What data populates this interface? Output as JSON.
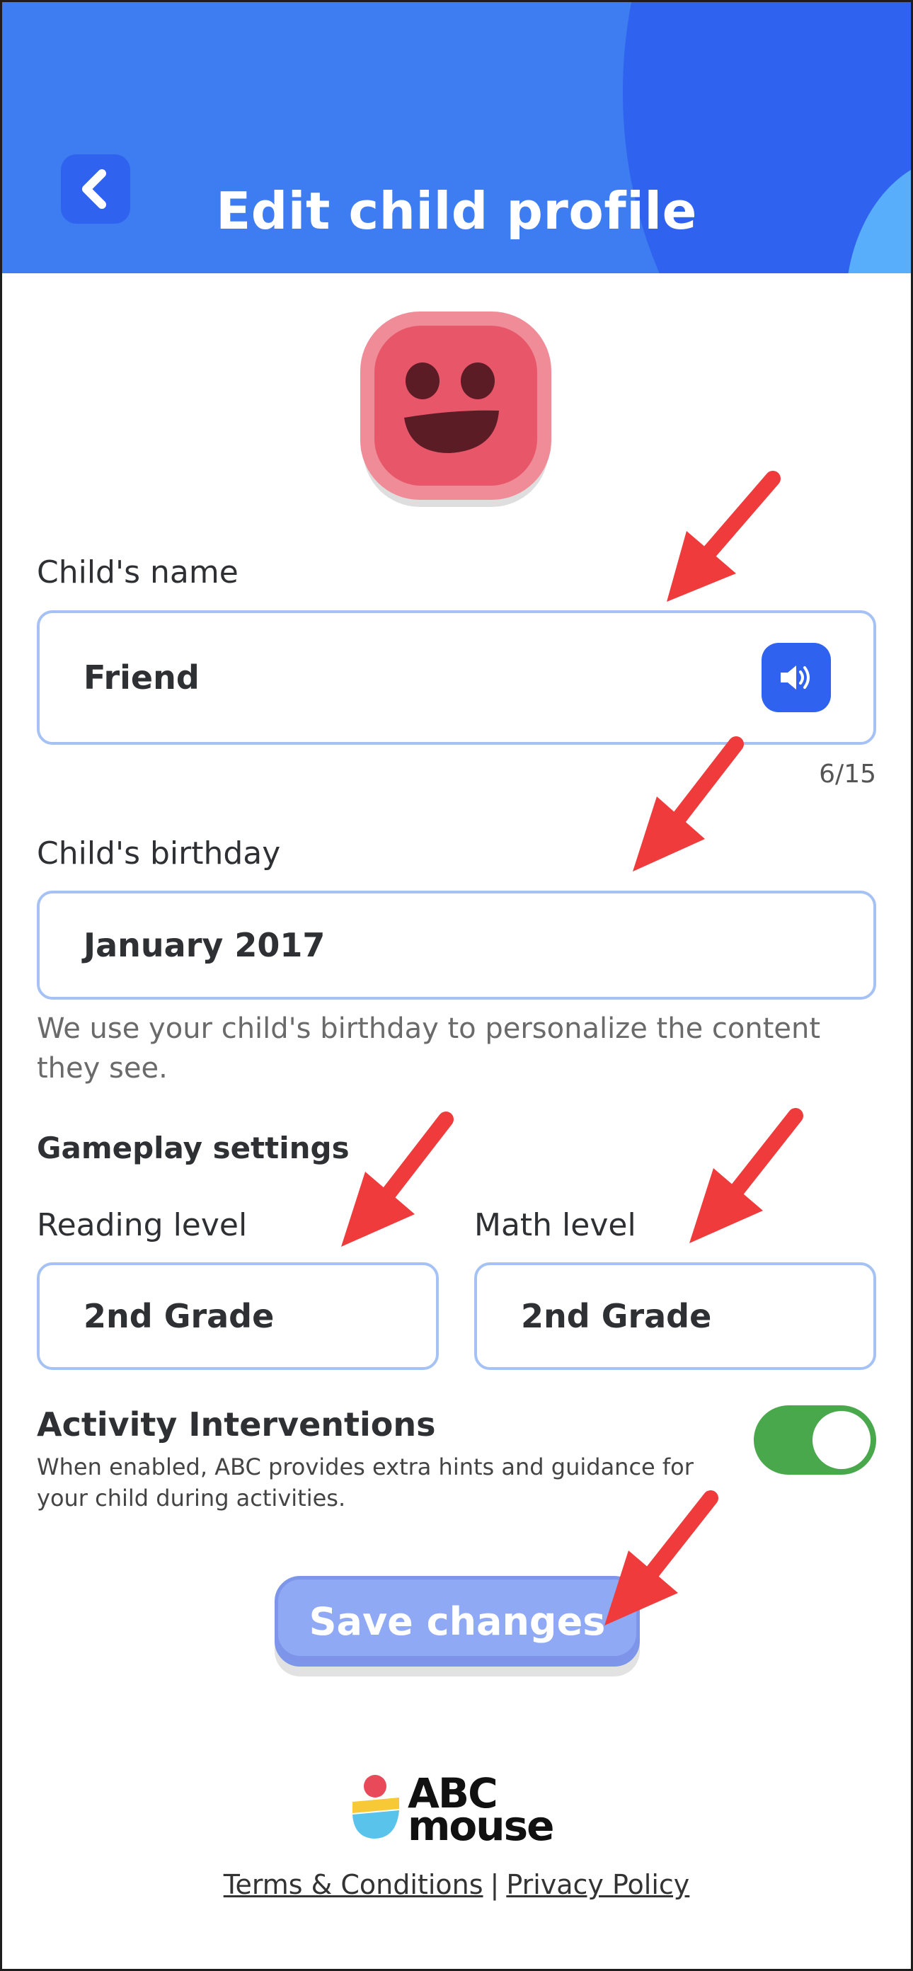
{
  "header": {
    "title": "Edit child profile",
    "back_icon": "chevron-left-icon"
  },
  "avatar": {
    "icon": "smiling-face-avatar",
    "color": "#e8566a"
  },
  "name_field": {
    "label": "Child's name",
    "value": "Friend",
    "counter": "6/15",
    "speaker_icon": "speaker-icon"
  },
  "birthday_field": {
    "label": "Child's birthday",
    "value": "January 2017",
    "helper": "We use your child's birthday to personalize the content they see."
  },
  "gameplay": {
    "title": "Gameplay settings",
    "reading": {
      "label": "Reading level",
      "value": "2nd Grade"
    },
    "math": {
      "label": "Math level",
      "value": "2nd Grade"
    }
  },
  "interventions": {
    "title": "Activity Interventions",
    "description": "When enabled, ABC provides extra hints and guidance for your child during activities.",
    "enabled": true
  },
  "save_label": "Save changes",
  "logo": {
    "line1": "ABC",
    "line2": "mouse"
  },
  "footer": {
    "terms": "Terms & Conditions",
    "separator": "|",
    "privacy": "Privacy Policy"
  },
  "colors": {
    "header": "#3d7cf1",
    "accent": "#2f62ee",
    "field_border": "#a6c2f5",
    "toggle_on": "#4aa84c",
    "save_button": "#8fa9f4",
    "annotation_arrow": "#ef3b3b"
  }
}
